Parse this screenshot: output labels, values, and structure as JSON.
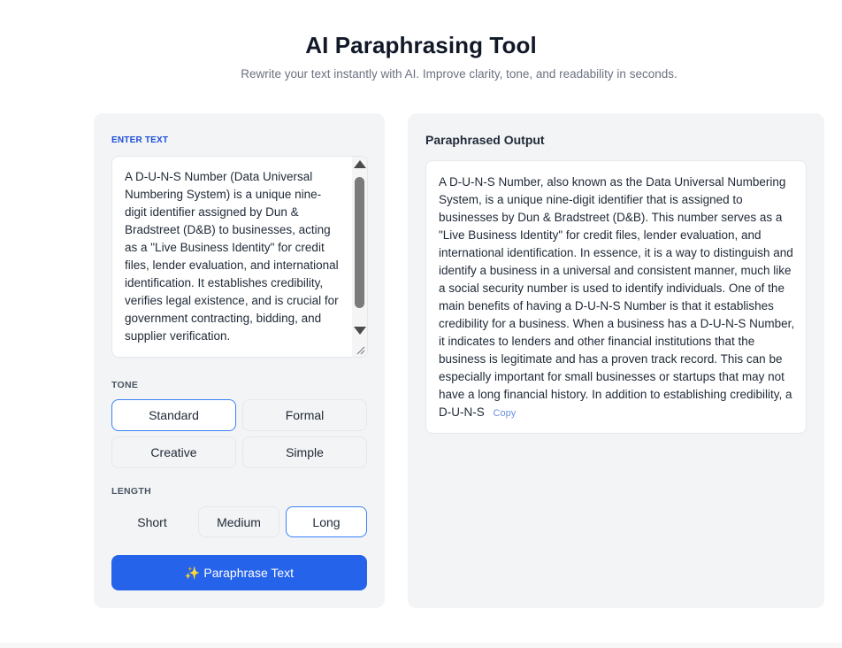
{
  "header": {
    "title": "AI Paraphrasing Tool",
    "subtitle": "Rewrite your text instantly with AI. Improve clarity, tone, and readability in seconds."
  },
  "input": {
    "label": "ENTER TEXT",
    "text": "A D-U-N-S Number (Data Universal Numbering System) is a unique nine-digit identifier assigned by Dun & Bradstreet (D&B) to businesses, acting as a \"Live Business Identity\" for credit files, lender evaluation, and international identification. It establishes credibility, verifies legal existence, and is crucial for government contracting, bidding, and supplier verification."
  },
  "tone": {
    "label": "TONE",
    "options": [
      "Standard",
      "Formal",
      "Creative",
      "Simple"
    ],
    "selected": "Standard"
  },
  "length": {
    "label": "LENGTH",
    "options": [
      "Short",
      "Medium",
      "Long"
    ],
    "selected": "Long"
  },
  "action": {
    "icon": "sparkles-icon",
    "label": "Paraphrase Text"
  },
  "output": {
    "title": "Paraphrased Output",
    "text": "A D-U-N-S Number, also known as the Data Universal Numbering System, is a unique nine-digit identifier that is assigned to businesses by Dun & Bradstreet (D&B). This number serves as a \"Live Business Identity\" for credit files, lender evaluation, and international identification. In essence, it is a way to distinguish and identify a business in a universal and consistent manner, much like a social security number is used to identify individuals. One of the main benefits of having a D-U-N-S Number is that it establishes credibility for a business. When a business has a D-U-N-S Number, it indicates to lenders and other financial institutions that the business is legitimate and has a proven track record. This can be especially important for small businesses or startups that may not have a long financial history. In addition to establishing credibility, a D-U-N-S",
    "copy_label": "Copy"
  },
  "colors": {
    "accent": "#2563eb",
    "selected_border": "#3b82f6",
    "panel_bg": "#f3f4f6"
  }
}
